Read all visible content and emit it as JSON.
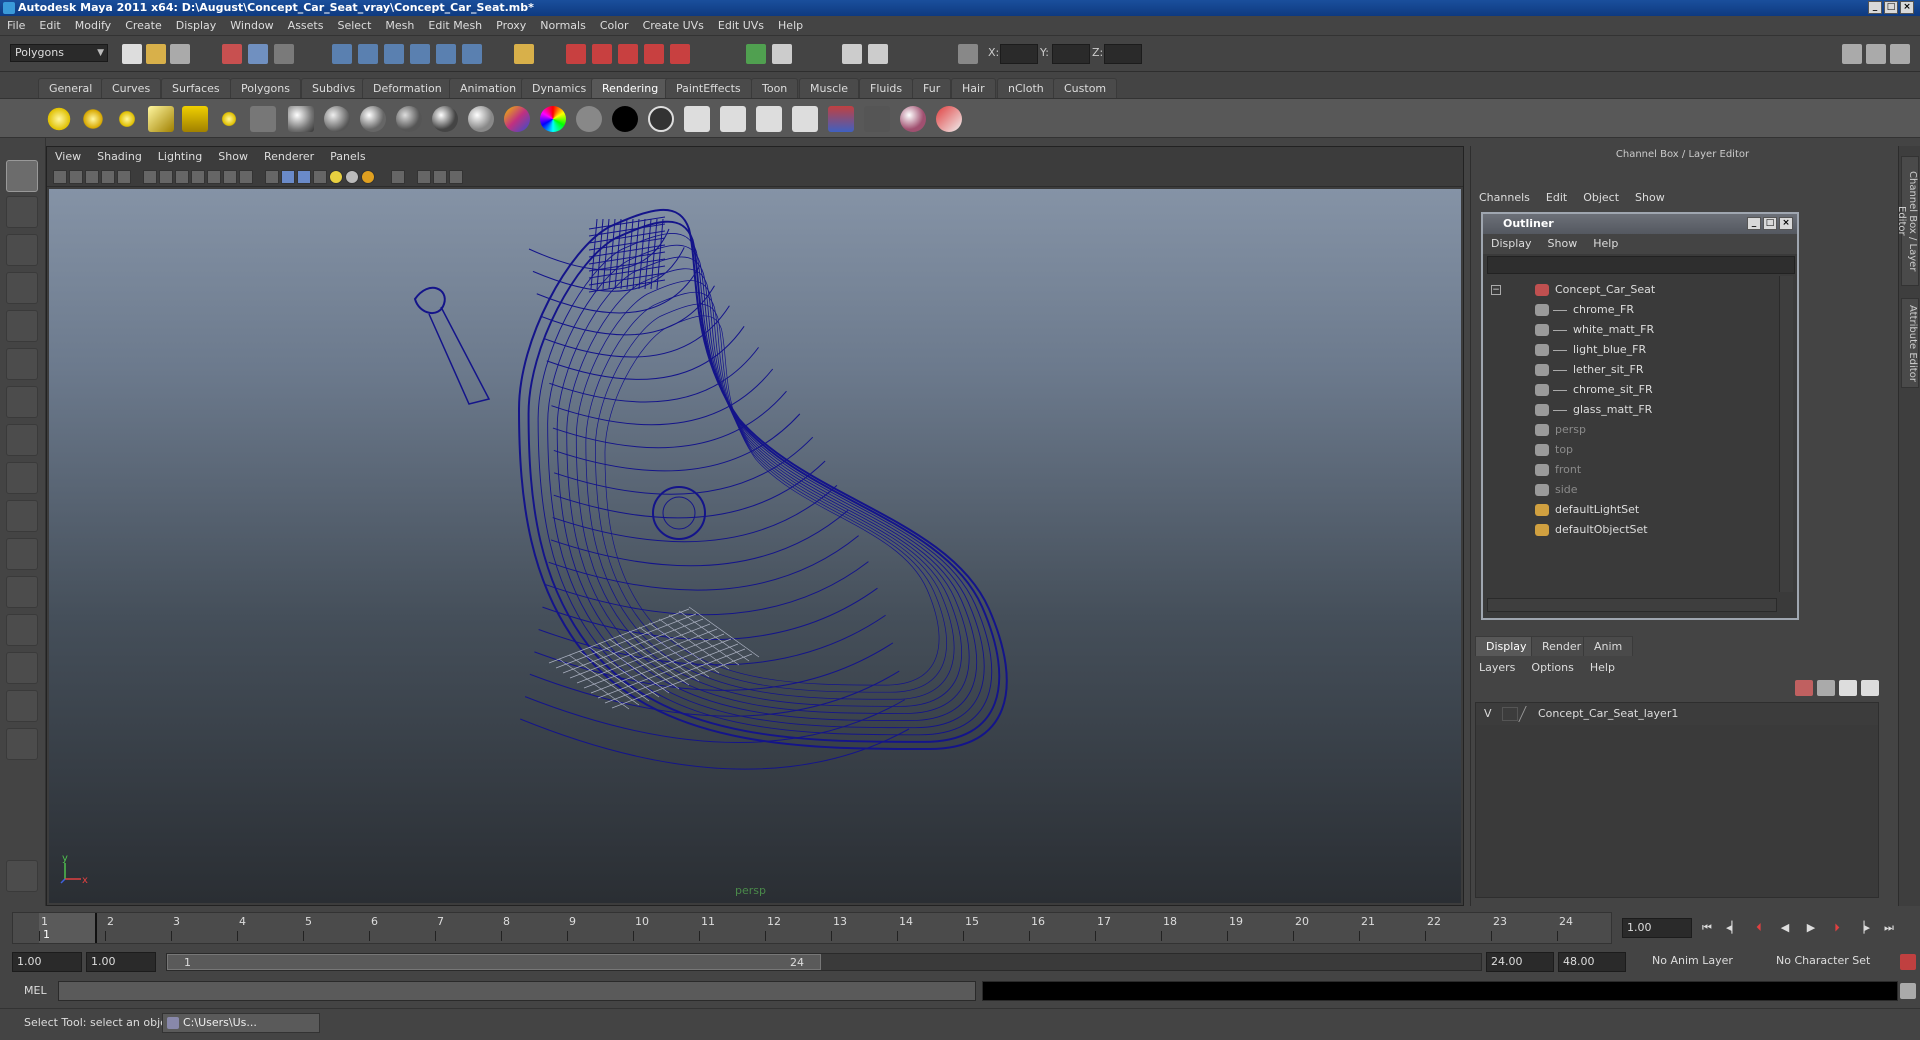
{
  "window": {
    "title": "Autodesk Maya 2011 x64: D:\\August\\Concept_Car_Seat_vray\\Concept_Car_Seat.mb*"
  },
  "menubar": [
    "File",
    "Edit",
    "Modify",
    "Create",
    "Display",
    "Window",
    "Assets",
    "Select",
    "Mesh",
    "Edit Mesh",
    "Proxy",
    "Normals",
    "Color",
    "Create UVs",
    "Edit UVs",
    "Help"
  ],
  "status_line": {
    "mode": "Polygons",
    "x_label": "X:",
    "y_label": "Y:",
    "z_label": "Z:"
  },
  "shelf": {
    "tabs": [
      "General",
      "Curves",
      "Surfaces",
      "Polygons",
      "Subdivs",
      "Deformation",
      "Animation",
      "Dynamics",
      "Rendering",
      "PaintEffects",
      "Toon",
      "Muscle",
      "Fluids",
      "Fur",
      "Hair",
      "nCloth",
      "Custom"
    ],
    "active_tab": "Rendering"
  },
  "viewport": {
    "menus": [
      "View",
      "Shading",
      "Lighting",
      "Show",
      "Renderer",
      "Panels"
    ],
    "camera_label": "persp",
    "axis_y": "y",
    "axis_x": "x",
    "wireframe_color": "#14148a"
  },
  "channel_box": {
    "header": "Channel Box / Layer Editor",
    "menus": [
      "Channels",
      "Edit",
      "Object",
      "Show"
    ]
  },
  "outliner": {
    "title": "Outliner",
    "menus": [
      "Display",
      "Show",
      "Help"
    ],
    "items": [
      {
        "label": "Concept_Car_Seat",
        "indent": 0,
        "icon": "group-icon"
      },
      {
        "label": "chrome_FR",
        "indent": 1,
        "icon": "mesh-icon"
      },
      {
        "label": "white_matt_FR",
        "indent": 1,
        "icon": "mesh-icon"
      },
      {
        "label": "light_blue_FR",
        "indent": 1,
        "icon": "mesh-icon"
      },
      {
        "label": "lether_sit_FR",
        "indent": 1,
        "icon": "mesh-icon"
      },
      {
        "label": "chrome_sit_FR",
        "indent": 1,
        "icon": "mesh-icon"
      },
      {
        "label": "glass_matt_FR",
        "indent": 1,
        "icon": "mesh-icon"
      },
      {
        "label": "persp",
        "indent": 0,
        "icon": "camera-icon",
        "dim": true
      },
      {
        "label": "top",
        "indent": 0,
        "icon": "camera-icon",
        "dim": true
      },
      {
        "label": "front",
        "indent": 0,
        "icon": "camera-icon",
        "dim": true
      },
      {
        "label": "side",
        "indent": 0,
        "icon": "camera-icon",
        "dim": true
      },
      {
        "label": "defaultLightSet",
        "indent": 0,
        "icon": "set-icon"
      },
      {
        "label": "defaultObjectSet",
        "indent": 0,
        "icon": "set-icon"
      }
    ]
  },
  "layer_editor": {
    "tabs": [
      "Display",
      "Render",
      "Anim"
    ],
    "active_tab": "Display",
    "menus": [
      "Layers",
      "Options",
      "Help"
    ],
    "layer_visibility": "V",
    "layer_name": "Concept_Car_Seat_layer1"
  },
  "side_tabs": [
    "Channel Box / Layer Editor",
    "Attribute Editor"
  ],
  "time_slider": {
    "frames": [
      "1",
      "2",
      "3",
      "4",
      "5",
      "6",
      "7",
      "8",
      "9",
      "10",
      "11",
      "12",
      "13",
      "14",
      "15",
      "16",
      "17",
      "18",
      "19",
      "20",
      "21",
      "22",
      "23",
      "24"
    ],
    "current_frame_marker": "1",
    "current_time": "1.00"
  },
  "range_slider": {
    "start_time": "1.00",
    "playback_start": "1.00",
    "range_start_label": "1",
    "range_end_label": "24",
    "playback_end": "24.00",
    "end_time": "48.00",
    "anim_layer": "No Anim Layer",
    "character_set": "No Character Set"
  },
  "command_line": {
    "label": "MEL"
  },
  "help_line": {
    "text": "Select Tool: select an object",
    "task_button": "C:\\Users\\Us..."
  }
}
